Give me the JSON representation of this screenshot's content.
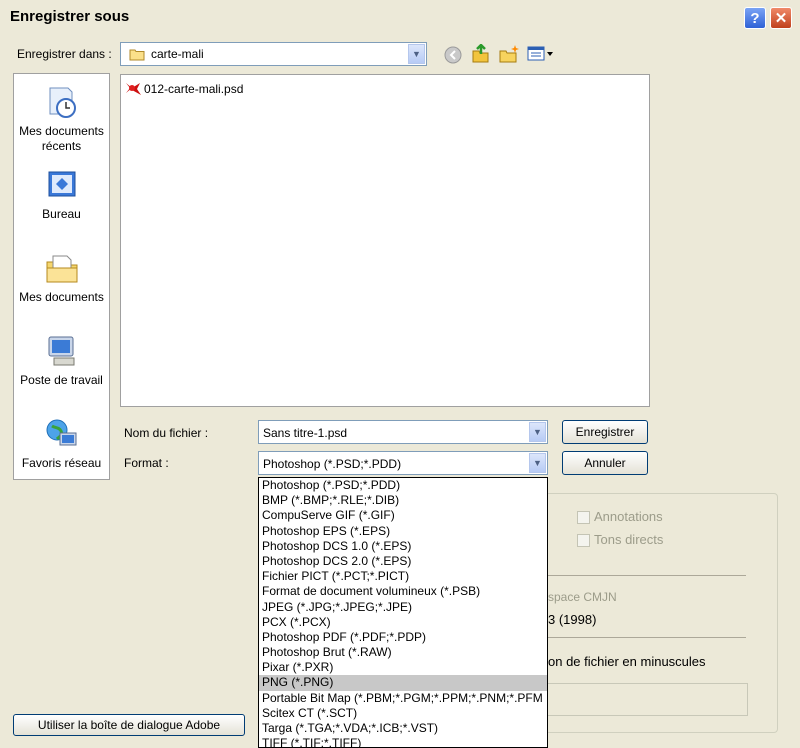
{
  "window": {
    "title": "Enregistrer sous",
    "help_glyph": "?",
    "close_glyph": "✕"
  },
  "save_in": {
    "label": "Enregistrer dans :",
    "value": "carte-mali"
  },
  "places": [
    {
      "label": "Mes documents récents",
      "icon": "recent-documents-icon"
    },
    {
      "label": "Bureau",
      "icon": "desktop-icon"
    },
    {
      "label": "Mes documents",
      "icon": "my-documents-icon"
    },
    {
      "label": "Poste de travail",
      "icon": "my-computer-icon"
    },
    {
      "label": "Favoris réseau",
      "icon": "network-places-icon"
    }
  ],
  "files": [
    {
      "name": "012-carte-mali.psd",
      "icon": "psd-file-icon"
    }
  ],
  "filename": {
    "label": "Nom du fichier :",
    "value": "Sans titre-1.psd"
  },
  "format": {
    "label": "Format :",
    "value": "Photoshop (*.PSD;*.PDD)",
    "options": [
      "Photoshop (*.PSD;*.PDD)",
      "BMP (*.BMP;*.RLE;*.DIB)",
      "CompuServe GIF (*.GIF)",
      "Photoshop EPS (*.EPS)",
      "Photoshop DCS 1.0 (*.EPS)",
      "Photoshop DCS 2.0 (*.EPS)",
      "Fichier PICT (*.PCT;*.PICT)",
      "Format de document volumineux (*.PSB)",
      "JPEG (*.JPG;*.JPEG;*.JPE)",
      "PCX (*.PCX)",
      "Photoshop PDF (*.PDF;*.PDP)",
      "Photoshop Brut (*.RAW)",
      "Pixar (*.PXR)",
      "PNG (*.PNG)",
      "Portable Bit Map (*.PBM;*.PGM;*.PPM;*.PNM;*.PFM",
      "Scitex CT (*.SCT)",
      "Targa (*.TGA;*.VDA;*.ICB;*.VST)",
      "TIFF (*.TIF;*.TIFF)"
    ],
    "selected_option": "PNG (*.PNG)"
  },
  "buttons": {
    "save": "Enregistrer",
    "cancel": "Annuler",
    "adobe_dialog": "Utiliser la boîte de dialogue Adobe"
  },
  "options_partial": {
    "annotations": "Annotations",
    "spot_colors": "Tons directs",
    "cmyk_fragment": "space CMJN",
    "year_fragment": "3 (1998)",
    "lowercase_fragment": "on de fichier en minuscules"
  },
  "colors": {
    "dialog_bg": "#ece9d8",
    "selection": "#c8c8c8",
    "folder_yellow": "#f5d66e"
  }
}
